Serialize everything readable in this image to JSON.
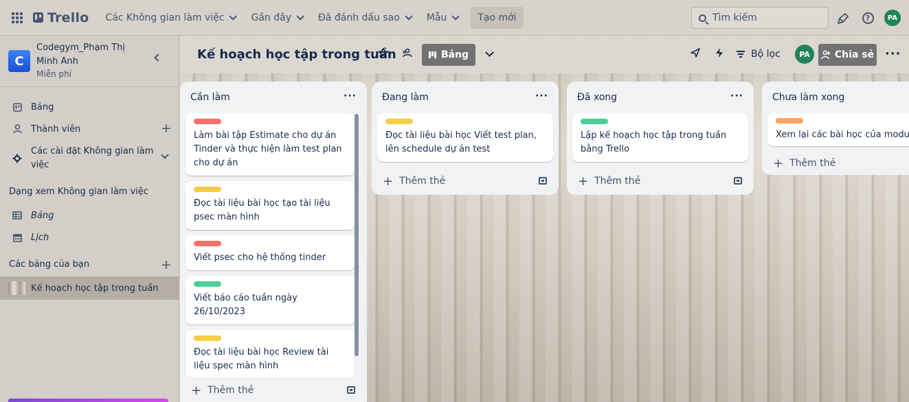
{
  "nav": {
    "logo": "Trello",
    "workspaces": "Các Không gian làm việc",
    "recent": "Gần đây",
    "starred": "Đã đánh dấu sao",
    "templates": "Mẫu",
    "create": "Tạo mới",
    "search_placeholder": "Tìm kiếm",
    "avatar": "PA"
  },
  "sidebar": {
    "workspace_initial": "C",
    "workspace_name": "Codegym_Phạm Thị Minh Anh",
    "workspace_plan": "Miễn phí",
    "items": [
      {
        "label": "Bảng",
        "icon": "board-icon"
      },
      {
        "label": "Thành viên",
        "icon": "member-icon"
      },
      {
        "label": "Các cài đặt Không gian làm việc",
        "icon": "gear-icon"
      }
    ],
    "views_heading": "Dạng xem Không gian làm việc",
    "views": [
      {
        "label": "Bảng",
        "icon": "table-icon"
      },
      {
        "label": "Lịch",
        "icon": "calendar-icon"
      }
    ],
    "boards_heading": "Các bảng của bạn",
    "boards": [
      {
        "label": "Kế hoạch học tập trong tuần",
        "active": true
      }
    ]
  },
  "board": {
    "title": "Kế hoạch học tập trong tuần",
    "view_label": "Bảng",
    "filter_label": "Bộ lọc",
    "avatar": "PA",
    "share_label": "Chia sẻ"
  },
  "colors": {
    "red": "#f87168",
    "yellow": "#f5cd47",
    "green": "#4bce97",
    "orange": "#fea362",
    "avatar_green": "#1f845a"
  },
  "lists": [
    {
      "title": "Cần làm",
      "add_label": "Thêm thẻ",
      "cards": [
        {
          "label_color": "red",
          "text": "Làm bài tập Estimate cho dự án Tinder và thực hiện làm test plan cho dự án"
        },
        {
          "label_color": "yellow",
          "text": "Đọc tài liệu bài học tạo tài liệu psec màn hình"
        },
        {
          "label_color": "red",
          "text": "Viết psec cho hệ thống tinder"
        },
        {
          "label_color": "green",
          "text": "Viết báo cáo tuần ngày 26/10/2023"
        },
        {
          "label_color": "yellow",
          "text": "Đọc tài liệu bài học Review tài liệu spec màn hình"
        },
        {
          "label_color": "orange",
          "text": ""
        }
      ]
    },
    {
      "title": "Đang làm",
      "add_label": "Thêm thẻ",
      "cards": [
        {
          "label_color": "yellow",
          "text": "Đọc tài liệu bài học Viết test plan, lên schedule dự án test"
        }
      ]
    },
    {
      "title": "Đã xong",
      "add_label": "Thêm thẻ",
      "cards": [
        {
          "label_color": "green",
          "text": "Lập kế hoạch học tập trong tuần bằng Trello"
        }
      ]
    },
    {
      "title": "Chưa làm xong",
      "add_label": "Thêm thẻ",
      "cards": [
        {
          "label_color": "orange",
          "text": "Xem lại các bài học của module"
        }
      ]
    }
  ]
}
